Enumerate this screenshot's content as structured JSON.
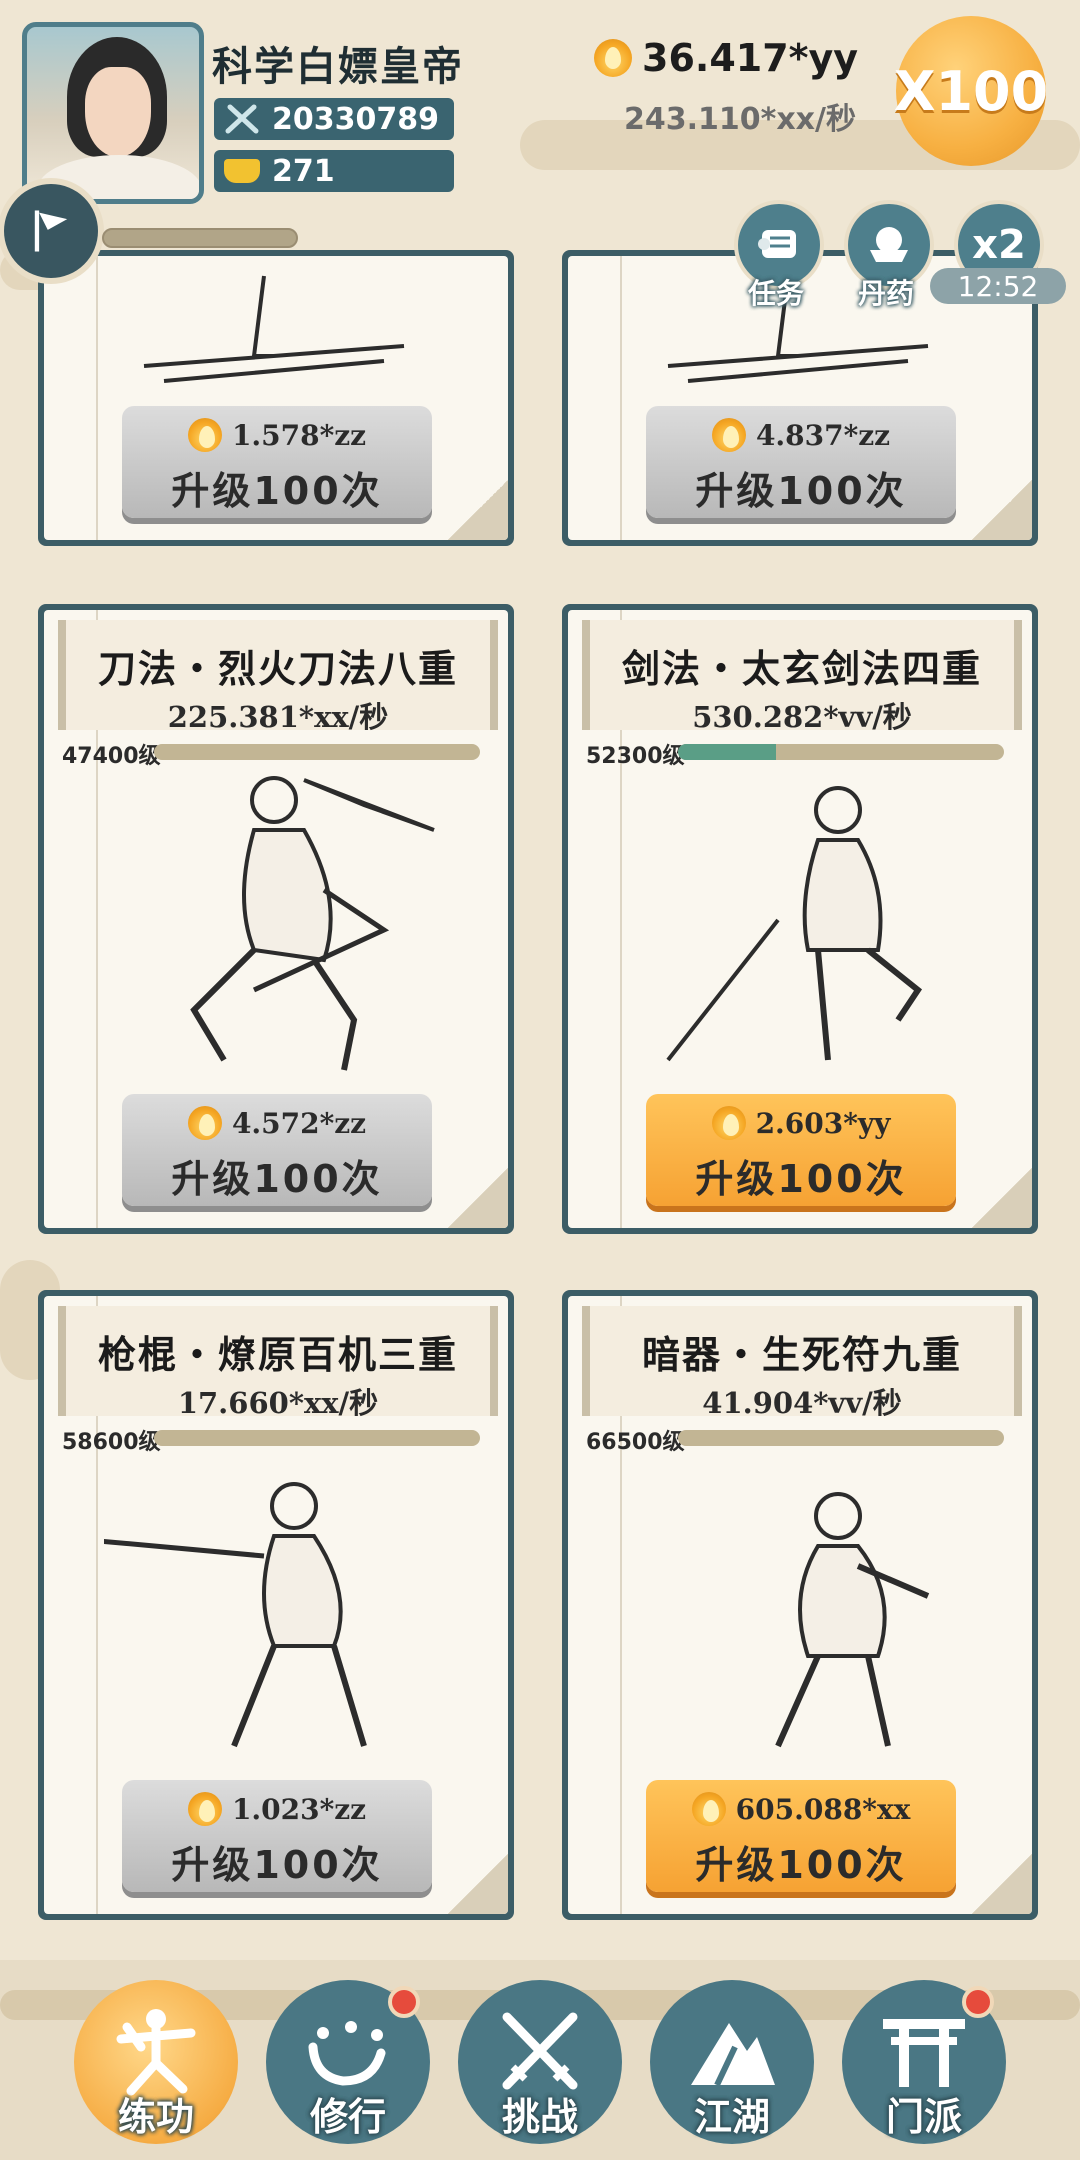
{
  "player": {
    "name": "科学白嫖皇帝",
    "power": "20330789",
    "gold": "271",
    "avatar": "avatar-portrait",
    "flag_icon": "flag-icon"
  },
  "currency": {
    "amount": "36.417*yy",
    "rate": "243.110*xx/秒",
    "multiplier": "X100"
  },
  "actions": {
    "tasks_label": "任务",
    "pills_label": "丹药",
    "x2_label": "x2",
    "timer": "12:52"
  },
  "cards": [
    {
      "title": "",
      "rate": "",
      "level": "",
      "progress": 0,
      "cost": "1.578*zz",
      "button_label": "升级100次",
      "affordable": false
    },
    {
      "title": "",
      "rate": "",
      "level": "",
      "progress": 0,
      "cost": "4.837*zz",
      "button_label": "升级100次",
      "affordable": false
    },
    {
      "title": "刀法・烈火刀法八重",
      "rate": "225.381*xx/秒",
      "level": "47400级",
      "progress": 0.0,
      "cost": "4.572*zz",
      "button_label": "升级100次",
      "affordable": false
    },
    {
      "title": "剑法・太玄剑法四重",
      "rate": "530.282*vv/秒",
      "level": "52300级",
      "progress": 0.3,
      "cost": "2.603*yy",
      "button_label": "升级100次",
      "affordable": true
    },
    {
      "title": "枪棍・燎原百机三重",
      "rate": "17.660*xx/秒",
      "level": "58600级",
      "progress": 0.0,
      "cost": "1.023*zz",
      "button_label": "升级100次",
      "affordable": false
    },
    {
      "title": "暗器・生死符九重",
      "rate": "41.904*vv/秒",
      "level": "66500级",
      "progress": 0.0,
      "cost": "605.088*xx",
      "button_label": "升级100次",
      "affordable": true
    }
  ],
  "nav": [
    {
      "label": "练功",
      "icon": "martial-art-icon",
      "active": true,
      "badge": false
    },
    {
      "label": "修行",
      "icon": "heart-icon",
      "active": false,
      "badge": true
    },
    {
      "label": "挑战",
      "icon": "crossed-swords-icon",
      "active": false,
      "badge": false
    },
    {
      "label": "江湖",
      "icon": "mountain-icon",
      "active": false,
      "badge": false
    },
    {
      "label": "门派",
      "icon": "gate-icon",
      "active": false,
      "badge": true
    }
  ],
  "colors": {
    "accent": "#f6a233",
    "panel": "#3c5d66",
    "progress": "#5a9e86",
    "badge": "#e64b3c"
  }
}
